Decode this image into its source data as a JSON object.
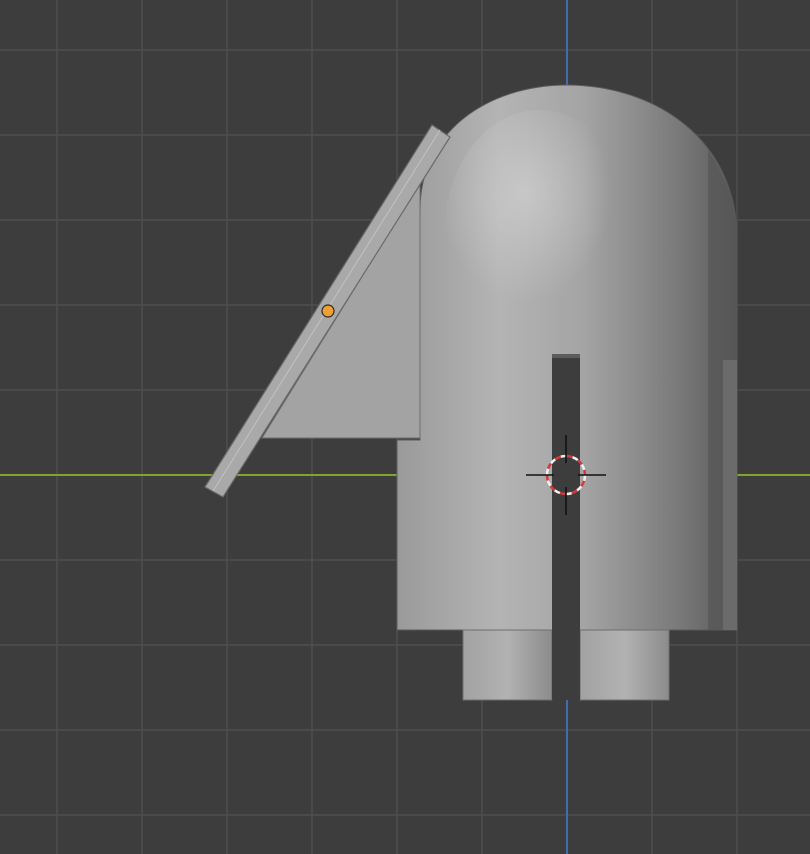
{
  "viewport": {
    "view": "orthographic-side",
    "background_color": "#3d3d3d",
    "grid_minor_color": "#434343",
    "grid_major_color": "#4f4f4f",
    "x_axis_color": "#7fa52c",
    "z_axis_color": "#3b6fb2"
  },
  "scene": {
    "main_body": {
      "shape": "capsule-with-slot",
      "base_color": "#a7a7a7",
      "shadow_color": "#6a6a6a",
      "highlight_color": "#bdbdbd"
    },
    "slant_panel": {
      "shape": "angled-plate",
      "color": "#9e9e9e",
      "edge_color": "#b0b0b0"
    },
    "origin_dot": {
      "color": "#f0a030"
    },
    "cursor_3d": {
      "ring_color_a": "#d43a3a",
      "ring_color_b": "#f0f0f0",
      "cross_color": "#111111"
    }
  }
}
